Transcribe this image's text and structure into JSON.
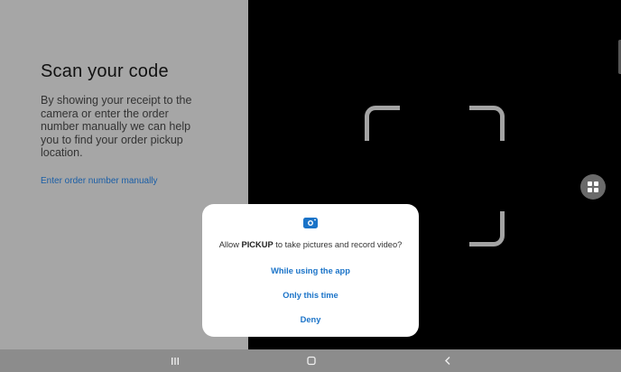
{
  "left": {
    "title": "Scan your code",
    "description": "By showing your receipt to the camera or enter the order number manually we can help you to find your order pickup location.",
    "manual_link": "Enter order number manually"
  },
  "camera": {
    "floating_button_icon": "grid-icon"
  },
  "dialog": {
    "icon": "camera-icon",
    "message_prefix": "Allow ",
    "app_name": "PICKUP",
    "message_suffix": " to take pictures and record video?",
    "buttons": {
      "while_using": "While using the app",
      "only_this_time": "Only this time",
      "deny": "Deny"
    }
  },
  "nav": {
    "recents_icon": "recents-icon",
    "home_icon": "home-icon",
    "back_icon": "back-icon"
  },
  "colors": {
    "accent": "#1a73c8",
    "link": "#1a5ea6",
    "left_panel_bg": "#a6a6a6",
    "camera_bg": "#000000",
    "nav_bg": "#8c8c8c"
  }
}
